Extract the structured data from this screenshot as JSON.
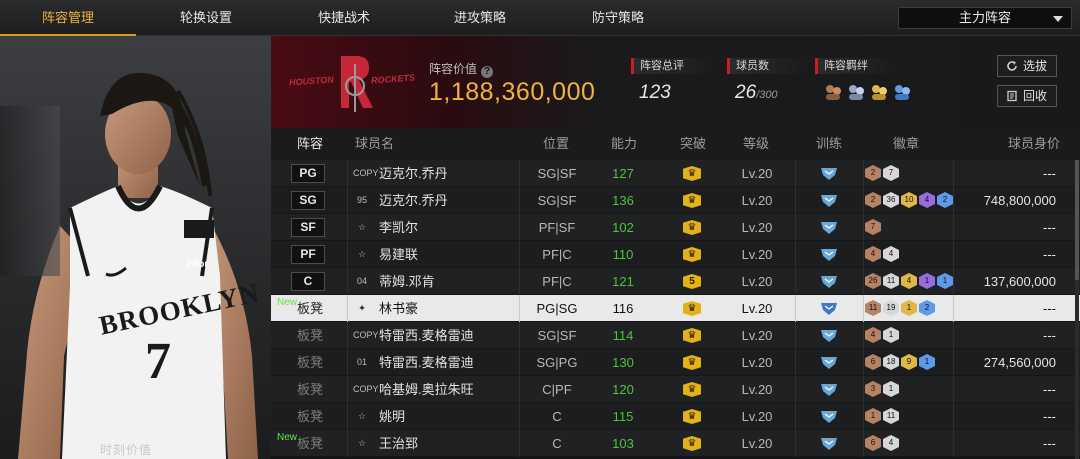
{
  "nav": {
    "tabs": [
      "阵容管理",
      "轮换设置",
      "快捷战术",
      "进攻策略",
      "防守策略"
    ],
    "active_index": 0,
    "lineup_select": "主力阵容"
  },
  "left_panel": {
    "jersey_team": "BROOKLYN",
    "jersey_number": "7",
    "sponsor": "infor",
    "caption": "时刻价值"
  },
  "header": {
    "team_logo_text_left": "HOUSTON",
    "team_logo_text_right": "ROCKETS",
    "value_label": "阵容价值",
    "value": "1,188,360,000",
    "overall_label": "阵容总评",
    "overall": "123",
    "player_count_label": "球员数",
    "player_count": "26",
    "player_count_max": "/300",
    "bond_label": "阵容羁绊",
    "btn_select": "选拔",
    "btn_recycle": "回收"
  },
  "table": {
    "headers": [
      "阵容",
      "球员名",
      "位置",
      "能力",
      "突破",
      "等级",
      "训练",
      "徽章",
      "球员身价"
    ],
    "rows": [
      {
        "slot": "PG",
        "is_bench": false,
        "new": false,
        "num": "COPY",
        "name": "迈克尔.乔丹",
        "position": "SG|SF",
        "ability": "127",
        "breakthrough": "",
        "level": "Lv.20",
        "badges": [
          [
            "b-bronze",
            "2"
          ],
          [
            "b-silver",
            "7"
          ]
        ],
        "value": "---",
        "highlight": false
      },
      {
        "slot": "SG",
        "is_bench": false,
        "new": false,
        "num": "95",
        "name": "迈克尔.乔丹",
        "position": "SG|SF",
        "ability": "136",
        "breakthrough": "",
        "level": "Lv.20",
        "badges": [
          [
            "b-bronze",
            "2"
          ],
          [
            "b-silver",
            "36"
          ],
          [
            "b-gold",
            "10"
          ],
          [
            "b-purple",
            "4"
          ],
          [
            "b-blue",
            "2"
          ]
        ],
        "value": "748,800,000",
        "highlight": false
      },
      {
        "slot": "SF",
        "is_bench": false,
        "new": false,
        "num": "☆",
        "name": "李凯尔",
        "position": "PF|SF",
        "ability": "102",
        "breakthrough": "",
        "level": "Lv.20",
        "badges": [
          [
            "b-bronze",
            "7"
          ]
        ],
        "value": "---",
        "highlight": false
      },
      {
        "slot": "PF",
        "is_bench": false,
        "new": false,
        "num": "☆",
        "name": "易建联",
        "position": "PF|C",
        "ability": "110",
        "breakthrough": "",
        "level": "Lv.20",
        "badges": [
          [
            "b-bronze",
            "4"
          ],
          [
            "b-silver",
            "4"
          ]
        ],
        "value": "---",
        "highlight": false
      },
      {
        "slot": "C",
        "is_bench": false,
        "new": false,
        "num": "04",
        "name": "蒂姆.邓肯",
        "position": "PF|C",
        "ability": "121",
        "breakthrough": "5",
        "level": "Lv.20",
        "badges": [
          [
            "b-bronze",
            "26"
          ],
          [
            "b-silver",
            "11"
          ],
          [
            "b-gold",
            "4"
          ],
          [
            "b-purple",
            "1"
          ],
          [
            "b-blue",
            "1"
          ]
        ],
        "value": "137,600,000",
        "highlight": false
      },
      {
        "slot": "板凳",
        "is_bench": true,
        "new": true,
        "num": "✦",
        "name": "林书豪",
        "position": "PG|SG",
        "ability": "116",
        "breakthrough": "",
        "level": "Lv.20",
        "badges": [
          [
            "b-bronze",
            "11"
          ],
          [
            "b-silver",
            "19"
          ],
          [
            "b-gold",
            "1"
          ],
          [
            "b-blue",
            "2"
          ]
        ],
        "value": "---",
        "highlight": true
      },
      {
        "slot": "板凳",
        "is_bench": true,
        "new": false,
        "num": "COPY",
        "name": "特雷西.麦格雷迪",
        "position": "SG|SF",
        "ability": "114",
        "breakthrough": "",
        "level": "Lv.20",
        "badges": [
          [
            "b-bronze",
            "4"
          ],
          [
            "b-silver",
            "1"
          ]
        ],
        "value": "---",
        "highlight": false
      },
      {
        "slot": "板凳",
        "is_bench": true,
        "new": false,
        "num": "01",
        "name": "特雷西.麦格雷迪",
        "position": "SG|PG",
        "ability": "130",
        "breakthrough": "",
        "level": "Lv.20",
        "badges": [
          [
            "b-bronze",
            "6"
          ],
          [
            "b-silver",
            "18"
          ],
          [
            "b-gold",
            "9"
          ],
          [
            "b-blue",
            "1"
          ]
        ],
        "value": "274,560,000",
        "highlight": false
      },
      {
        "slot": "板凳",
        "is_bench": true,
        "new": false,
        "num": "COPY",
        "name": "哈基姆.奥拉朱旺",
        "position": "C|PF",
        "ability": "120",
        "breakthrough": "",
        "level": "Lv.20",
        "badges": [
          [
            "b-bronze",
            "3"
          ],
          [
            "b-silver",
            "1"
          ]
        ],
        "value": "---",
        "highlight": false
      },
      {
        "slot": "板凳",
        "is_bench": true,
        "new": false,
        "num": "☆",
        "name": "姚明",
        "position": "C",
        "ability": "115",
        "breakthrough": "",
        "level": "Lv.20",
        "badges": [
          [
            "b-bronze",
            "1"
          ],
          [
            "b-silver",
            "11"
          ]
        ],
        "value": "---",
        "highlight": false
      },
      {
        "slot": "板凳",
        "is_bench": true,
        "new": true,
        "num": "☆",
        "name": "王治郅",
        "position": "C",
        "ability": "103",
        "breakthrough": "",
        "level": "Lv.20",
        "badges": [
          [
            "b-bronze",
            "6"
          ],
          [
            "b-silver",
            "4"
          ]
        ],
        "value": "---",
        "highlight": false
      }
    ],
    "new_tag": "New"
  }
}
